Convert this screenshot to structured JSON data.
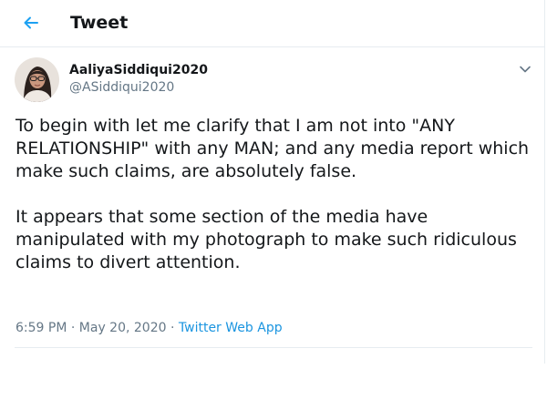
{
  "header": {
    "title": "Tweet",
    "back_icon": "arrow-left-icon"
  },
  "author": {
    "display_name": "AaliyaSiddiqui2020",
    "username": "@ASiddiqui2020",
    "avatar_icon": "avatar-photo"
  },
  "tweet": {
    "paragraphs": [
      "To begin with let me clarify that I am not into \"ANY RELATIONSHIP\" with any MAN; and any media report which make such claims, are absolutely false.",
      "It appears that some section of the media have manipulated with my photograph to make such ridiculous claims to divert attention."
    ],
    "time": "6:59 PM",
    "separator": "·",
    "date": "May 20, 2020",
    "source": "Twitter Web App"
  },
  "colors": {
    "accent": "#1da1f2",
    "link": "#1b95e0",
    "secondary_text": "#657786",
    "border": "#e6ecf0"
  },
  "menu": {
    "caret_icon": "chevron-down-icon"
  }
}
